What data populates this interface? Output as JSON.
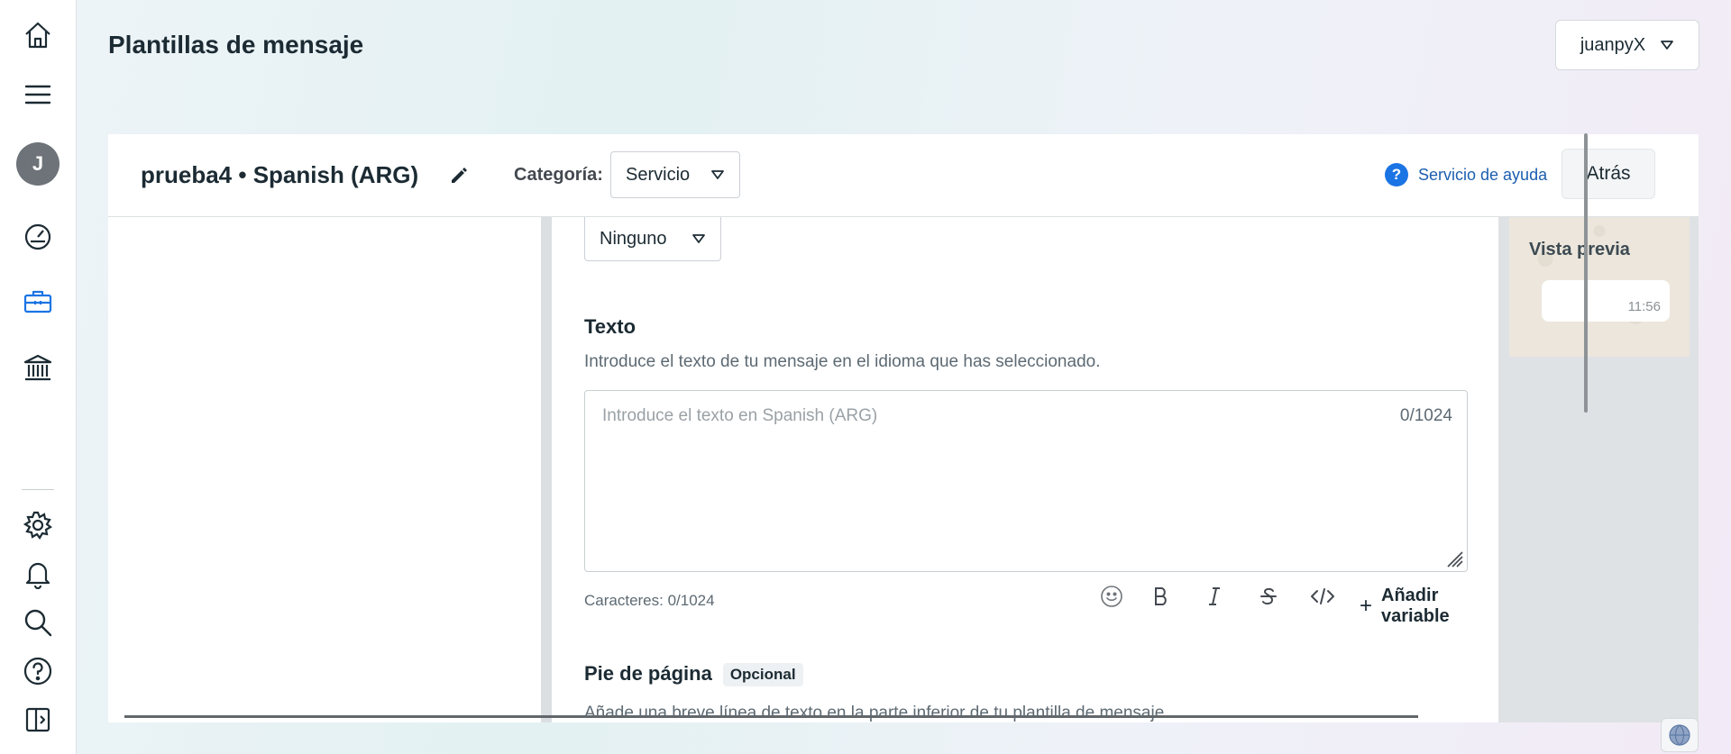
{
  "header": {
    "title": "Plantillas de mensaje",
    "account": "juanpyX"
  },
  "nav": {
    "avatar_initial": "J",
    "icons": [
      "home-icon",
      "menu-icon",
      "dashboard-icon",
      "briefcase-icon",
      "bank-icon",
      "gear-icon",
      "bell-icon",
      "search-icon",
      "help-icon",
      "sidebar-toggle-icon"
    ]
  },
  "template": {
    "name": "prueba4 • Spanish (ARG)",
    "category_label": "Categoría:",
    "category_value": "Servicio",
    "help_label": "Servicio de ayuda",
    "back_label": "Atrás"
  },
  "header_select": {
    "value": "Ninguno"
  },
  "body_section": {
    "title": "Texto",
    "description": "Introduce el texto de tu mensaje en el idioma que has seleccionado.",
    "placeholder": "Introduce el texto en Spanish (ARG)",
    "count": "0/1024",
    "chars_label": "Caracteres: 0/1024",
    "add_variable": "Añadir variable"
  },
  "footer_section": {
    "title": "Pie de página",
    "badge": "Opcional",
    "description": "Añade una breve línea de texto en la parte inferior de tu plantilla de mensaje."
  },
  "preview": {
    "title": "Vista previa",
    "time": "11:56"
  }
}
